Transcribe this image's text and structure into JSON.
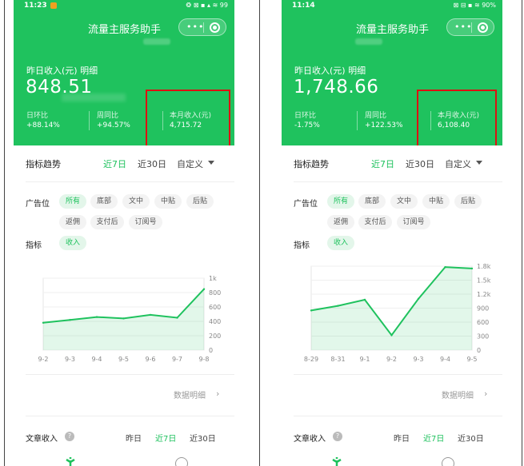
{
  "left": {
    "status": {
      "time": "11:23",
      "system": "❂ ⊠ ▪ ▴ ≋ 99"
    },
    "header": {
      "title": "流量主服务助手",
      "yesterday_label": "昨日收入(元) 明细",
      "yesterday_value": "848.51",
      "stats": [
        {
          "label": "日环比",
          "value": "+88.14%"
        },
        {
          "label": "周同比",
          "value": "+94.57%"
        },
        {
          "label": "本月收入(元)",
          "value": "4,715.72"
        }
      ]
    },
    "trend": {
      "title": "指标趋势",
      "tabs": [
        "近7日",
        "近30日",
        "自定义"
      ],
      "active_tab": 0
    },
    "filters": {
      "ad_label": "广告位",
      "ad_chips": [
        "所有",
        "底部",
        "文中",
        "中贴",
        "后贴",
        "返佣",
        "支付后",
        "订阅号"
      ],
      "metric_label": "指标",
      "metric_chip": "收入"
    },
    "chart_data": {
      "type": "line",
      "categories": [
        "9-2",
        "9-3",
        "9-4",
        "9-5",
        "9-6",
        "9-7",
        "9-8"
      ],
      "values": [
        380,
        420,
        460,
        440,
        490,
        450,
        848
      ],
      "y_ticks": [
        "1k",
        "800",
        "600",
        "400",
        "200",
        "0"
      ],
      "ylim": [
        0,
        1000
      ],
      "grid": true,
      "color": "#1fc25e"
    },
    "detail_link": "数据明细",
    "article": {
      "title": "文章收入",
      "tabs": [
        "昨日",
        "近7日",
        "近30日"
      ],
      "active_tab": 1
    }
  },
  "right": {
    "status": {
      "time": "11:14",
      "system": "⊠ ⊟ ▪ ≋ 90%"
    },
    "header": {
      "title": "流量主服务助手",
      "yesterday_label": "昨日收入(元) 明细",
      "yesterday_value": "1,748.66",
      "stats": [
        {
          "label": "日环比",
          "value": "-1.75%"
        },
        {
          "label": "周同比",
          "value": "+122.53%"
        },
        {
          "label": "本月收入(元)",
          "value": "6,108.40"
        }
      ]
    },
    "trend": {
      "title": "指标趋势",
      "tabs": [
        "近7日",
        "近30日",
        "自定义"
      ],
      "active_tab": 0
    },
    "filters": {
      "ad_label": "广告位",
      "ad_chips": [
        "所有",
        "底部",
        "文中",
        "中贴",
        "后贴",
        "返佣",
        "支付后",
        "订阅号"
      ],
      "metric_label": "指标",
      "metric_chip": "收入"
    },
    "chart_data": {
      "type": "line",
      "categories": [
        "8-29",
        "8-31",
        "9-1",
        "9-2",
        "9-3",
        "9-4",
        "9-5"
      ],
      "values": [
        850,
        950,
        1080,
        320,
        1100,
        1780,
        1750
      ],
      "y_ticks": [
        "1.8k",
        "1.5k",
        "1.2k",
        "900",
        "600",
        "300",
        "0"
      ],
      "ylim": [
        0,
        1800
      ],
      "grid": true,
      "color": "#1fc25e"
    },
    "detail_link": "数据明细",
    "article": {
      "title": "文章收入",
      "tabs": [
        "昨日",
        "近7日",
        "近30日"
      ],
      "active_tab": 1
    }
  },
  "colors": {
    "brand": "#1fc25e",
    "highlight_box": "#dd1111"
  }
}
